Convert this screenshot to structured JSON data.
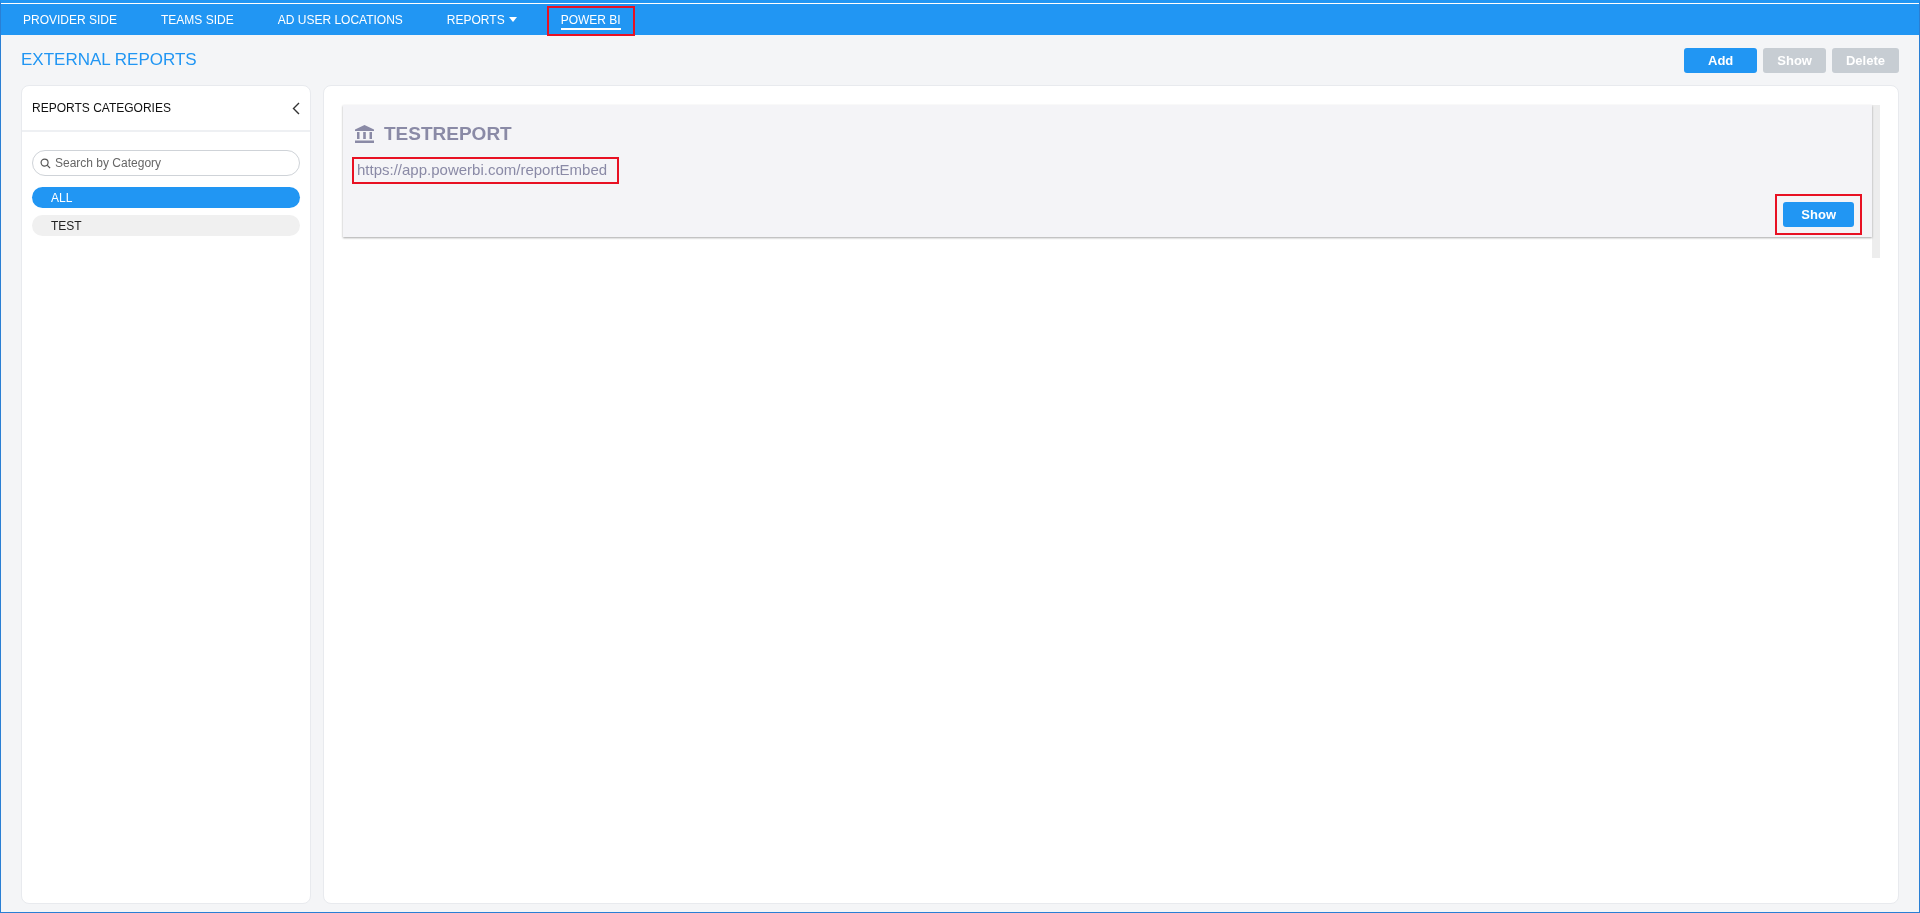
{
  "nav": {
    "items": [
      {
        "label": "PROVIDER SIDE",
        "selected": false,
        "dropdown": false,
        "highlighted": false
      },
      {
        "label": "TEAMS SIDE",
        "selected": false,
        "dropdown": false,
        "highlighted": false
      },
      {
        "label": "AD USER LOCATIONS",
        "selected": false,
        "dropdown": false,
        "highlighted": false
      },
      {
        "label": "REPORTS",
        "selected": false,
        "dropdown": true,
        "highlighted": false
      },
      {
        "label": "POWER BI",
        "selected": true,
        "dropdown": false,
        "highlighted": true
      }
    ]
  },
  "page_title": "EXTERNAL REPORTS",
  "toolbar": {
    "buttons": [
      {
        "label": "Add",
        "disabled": false
      },
      {
        "label": "Show",
        "disabled": true
      },
      {
        "label": "Delete",
        "disabled": true
      }
    ]
  },
  "sidebar": {
    "title": "REPORTS CATEGORIES",
    "search": {
      "placeholder": "Search by Category"
    },
    "categories": [
      {
        "label": "ALL",
        "selected": true
      },
      {
        "label": "TEST",
        "selected": false
      }
    ]
  },
  "reports": [
    {
      "title": "TESTREPORT",
      "url": "https://app.powerbi.com/reportEmbed",
      "url_highlighted": true,
      "button": "Show",
      "button_highlighted": true
    }
  ]
}
